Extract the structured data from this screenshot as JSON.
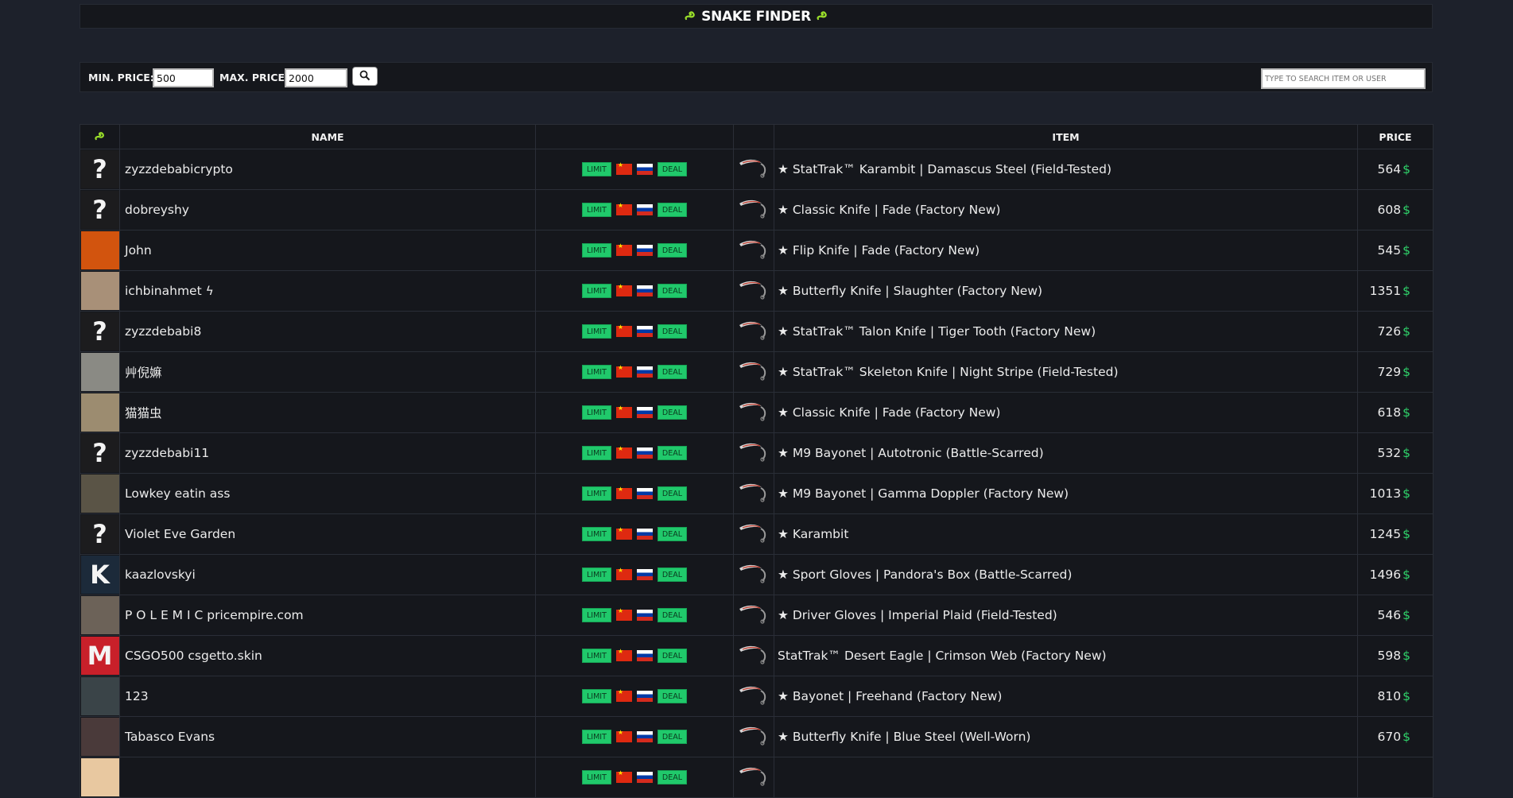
{
  "header": {
    "title": "SNAKE FINDER",
    "icon_left": "snake-icon",
    "icon_right": "snake-icon",
    "accent_color": "#9adf2a"
  },
  "filters": {
    "min_label": "MIN. PRICE:",
    "min_value": "500",
    "max_label": "MAX. PRICE:",
    "max_value": "2000",
    "search_button_icon": "magnifier-icon",
    "search_placeholder": "TYPE TO SEARCH ITEM OR USER"
  },
  "table": {
    "columns": {
      "avatar_icon": "snake-icon",
      "name": "NAME",
      "badges": "",
      "knife": "",
      "item": "ITEM",
      "price": "PRICE"
    },
    "badge_limit": "LIMIT",
    "badge_deal": "DEAL",
    "currency_symbol": "$",
    "badge_color": "#20c96b",
    "currency_color": "#2fd36a",
    "rows": [
      {
        "avatar": "?",
        "avatar_color": "#1c1c1e",
        "name": "zyzzdebabicrypto",
        "item": "★ StatTrak™ Karambit | Damascus Steel (Field-Tested)",
        "price": "564"
      },
      {
        "avatar": "?",
        "avatar_color": "#1c1c1e",
        "name": "dobreyshy",
        "item": "★ Classic Knife | Fade (Factory New)",
        "price": "608"
      },
      {
        "avatar": "",
        "avatar_color": "#d2540e",
        "name": "John",
        "item": "★ Flip Knife | Fade (Factory New)",
        "price": "545"
      },
      {
        "avatar": "",
        "avatar_color": "#a89078",
        "name": "ichbinahmet ϟ",
        "item": "★ Butterfly Knife | Slaughter (Factory New)",
        "price": "1351"
      },
      {
        "avatar": "?",
        "avatar_color": "#1c1c1e",
        "name": "zyzzdebabi8",
        "item": "★ StatTrak™ Talon Knife | Tiger Tooth (Factory New)",
        "price": "726"
      },
      {
        "avatar": "",
        "avatar_color": "#8a8a84",
        "name": "艸倪嫲",
        "item": "★ StatTrak™ Skeleton Knife | Night Stripe (Field-Tested)",
        "price": "729"
      },
      {
        "avatar": "",
        "avatar_color": "#9c8c70",
        "name": "猫猫虫",
        "item": "★ Classic Knife | Fade (Factory New)",
        "price": "618"
      },
      {
        "avatar": "?",
        "avatar_color": "#1c1c1e",
        "name": "zyzzdebabi11",
        "item": "★ M9 Bayonet | Autotronic (Battle-Scarred)",
        "price": "532"
      },
      {
        "avatar": "",
        "avatar_color": "#5a5446",
        "name": "Lowkey eatin ass",
        "item": "★ M9 Bayonet | Gamma Doppler (Factory New)",
        "price": "1013"
      },
      {
        "avatar": "?",
        "avatar_color": "#1c1c1e",
        "name": "Violet Eve Garden",
        "item": "★ Karambit",
        "price": "1245"
      },
      {
        "avatar": "K",
        "avatar_color": "#1c2a3a",
        "name": "kaazlovskyi",
        "item": "★ Sport Gloves | Pandora's Box (Battle-Scarred)",
        "price": "1496"
      },
      {
        "avatar": "",
        "avatar_color": "#6c6258",
        "name": "P O L E M I C pricempire.com",
        "item": "★ Driver Gloves | Imperial Plaid (Field-Tested)",
        "price": "546"
      },
      {
        "avatar": "M",
        "avatar_color": "#c8202a",
        "name": "CSGO500 csgetto.skin",
        "item": "StatTrak™ Desert Eagle | Crimson Web (Factory New)",
        "price": "598"
      },
      {
        "avatar": "",
        "avatar_color": "#3a4448",
        "name": "123",
        "item": "★ Bayonet | Freehand (Factory New)",
        "price": "810"
      },
      {
        "avatar": "",
        "avatar_color": "#4a3a3a",
        "name": "Tabasco Evans",
        "item": "★ Butterfly Knife | Blue Steel (Well-Worn)",
        "price": "670"
      },
      {
        "avatar": "",
        "avatar_color": "#e8c8a0",
        "name": "",
        "item": "",
        "price": ""
      }
    ]
  }
}
